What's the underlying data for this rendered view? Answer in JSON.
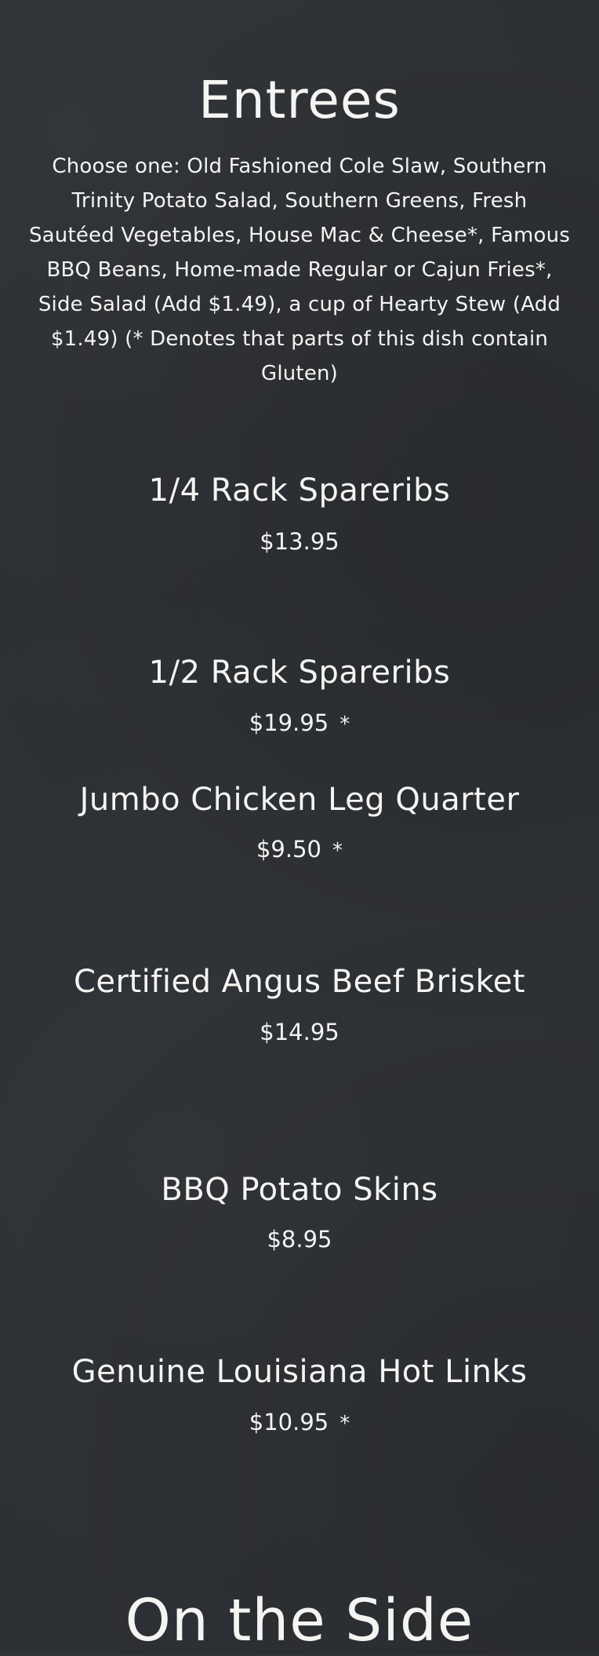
{
  "entrees": {
    "title": "Entrees",
    "description": "Choose one: Old Fashioned Cole Slaw, Southern Trinity Potato Salad, Southern Greens, Fresh Sautéed Vegetables, House Mac & Cheese*, Famous BBQ Beans, Home-made Regular or Cajun Fries*, Side Salad (Add $1.49), a cup of Hearty Stew (Add $1.49) (* Denotes that parts of this dish contain Gluten)",
    "items": [
      {
        "name": "1/4 Rack Spareribs",
        "price": "$13.95",
        "marker": ""
      },
      {
        "name": "1/2 Rack Spareribs",
        "price": "$19.95",
        "marker": "*"
      },
      {
        "name": "Jumbo Chicken Leg Quarter",
        "price": "$9.50",
        "marker": "*"
      },
      {
        "name": "Certified Angus Beef Brisket",
        "price": "$14.95",
        "marker": ""
      },
      {
        "name": "BBQ Potato Skins",
        "price": "$8.95",
        "marker": ""
      },
      {
        "name": "Genuine Louisiana Hot Links",
        "price": "$10.95",
        "marker": "*"
      }
    ]
  },
  "side": {
    "title": "On the Side"
  }
}
